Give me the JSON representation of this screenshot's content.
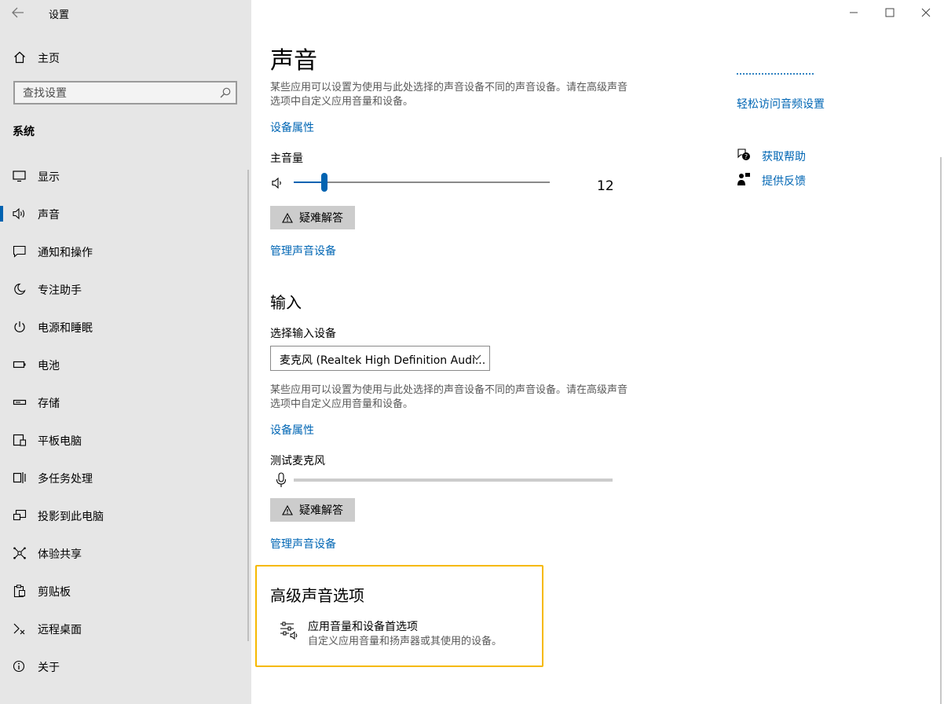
{
  "window": {
    "title": "设置",
    "minimize_icon": "minimize-icon",
    "maximize_icon": "maximize-icon",
    "close_icon": "close-icon"
  },
  "sidebar": {
    "home_label": "主页",
    "search_placeholder": "查找设置",
    "section_label": "系统",
    "items": [
      {
        "label": "显示",
        "icon": "display-icon"
      },
      {
        "label": "声音",
        "icon": "speaker-icon",
        "active": true
      },
      {
        "label": "通知和操作",
        "icon": "notification-icon"
      },
      {
        "label": "专注助手",
        "icon": "moon-icon"
      },
      {
        "label": "电源和睡眠",
        "icon": "power-icon"
      },
      {
        "label": "电池",
        "icon": "battery-icon"
      },
      {
        "label": "存储",
        "icon": "storage-icon"
      },
      {
        "label": "平板电脑",
        "icon": "tablet-icon"
      },
      {
        "label": "多任务处理",
        "icon": "multitask-icon"
      },
      {
        "label": "投影到此电脑",
        "icon": "project-icon"
      },
      {
        "label": "体验共享",
        "icon": "share-icon"
      },
      {
        "label": "剪贴板",
        "icon": "clipboard-icon"
      },
      {
        "label": "远程桌面",
        "icon": "remote-desktop-icon"
      },
      {
        "label": "关于",
        "icon": "info-icon"
      }
    ]
  },
  "main": {
    "title": "声音",
    "output_desc": "某些应用可以设置为使用与此处选择的声音设备不同的声音设备。请在高级声音选项中自定义应用音量和设备。",
    "output_device_props": "设备属性",
    "master_volume_label": "主音量",
    "master_volume_value": "12",
    "master_volume_level": 0.12,
    "troubleshoot_label": "疑难解答",
    "manage_devices_label": "管理声音设备",
    "input_heading": "输入",
    "choose_input_label": "选择输入设备",
    "input_device_value": "麦克风 (Realtek High Definition Audi...",
    "input_desc": "某些应用可以设置为使用与此处选择的声音设备不同的声音设备。请在高级声音选项中自定义应用音量和设备。",
    "input_device_props": "设备属性",
    "test_mic_label": "测试麦克风",
    "input_troubleshoot_label": "疑难解答",
    "input_manage_devices_label": "管理声音设备",
    "advanced_heading": "高级声音选项",
    "app_volume_title": "应用音量和设备首选项",
    "app_volume_subtitle": "自定义应用音量和扬声器或其使用的设备。"
  },
  "related": {
    "easy_access_link": "轻松访问音频设置",
    "get_help_link": "获取帮助",
    "feedback_link": "提供反馈"
  },
  "colors": {
    "accent": "#0063b1",
    "link": "#0066b4",
    "highlight_border": "#f6b900",
    "sidebar_bg": "#e6e6e6"
  }
}
